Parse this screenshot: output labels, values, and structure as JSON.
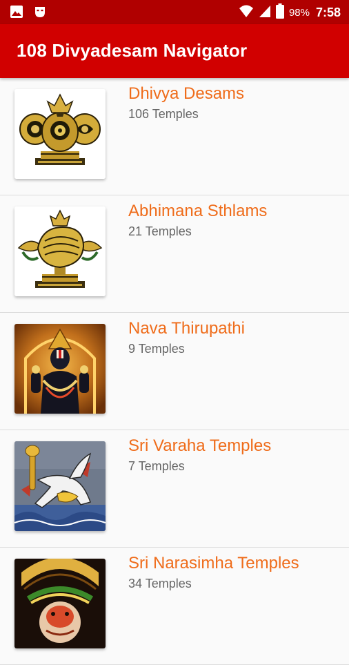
{
  "status_bar": {
    "left_icons": [
      "image-icon",
      "notification-mask-icon"
    ],
    "right_icons": [
      "wifi-icon",
      "signal-icon",
      "battery-icon"
    ],
    "battery_percent": "98%",
    "time": "7:58"
  },
  "app_bar": {
    "title": "108 Divyadesam Navigator"
  },
  "colors": {
    "status_bar": "#b00000",
    "app_bar": "#d10000",
    "item_title": "#ef6c1a",
    "item_subtitle": "#666666"
  },
  "items": [
    {
      "title": "Dhivya Desams",
      "subtitle": "106 Temples",
      "thumbnail": "shankha-chakra-namam-emblem"
    },
    {
      "title": "Abhimana Sthlams",
      "subtitle": "21 Temples",
      "thumbnail": "shankha-conch-emblem"
    },
    {
      "title": "Nava Thirupathi",
      "subtitle": "9 Temples",
      "thumbnail": "deity-photo"
    },
    {
      "title": "Sri Varaha Temples",
      "subtitle": "7 Temples",
      "thumbnail": "varaha-painting"
    },
    {
      "title": "Sri Narasimha Temples",
      "subtitle": "34 Temples",
      "thumbnail": "narasimha-photo"
    }
  ]
}
